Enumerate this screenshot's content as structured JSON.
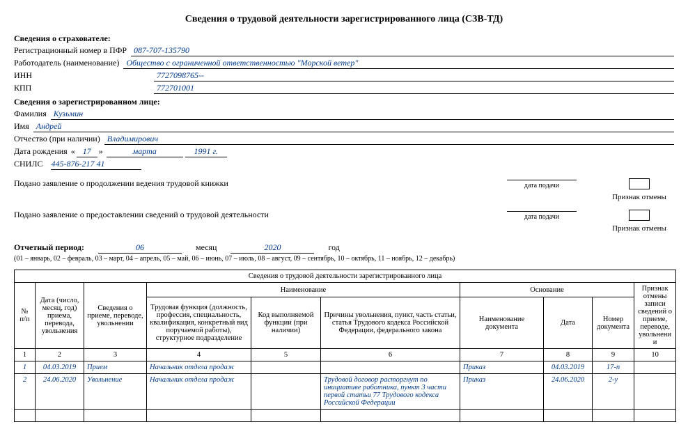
{
  "title": "Сведения о трудовой деятельности зарегистрированного лица (СЗВ-ТД)",
  "insurer": {
    "head": "Сведения о страхователе:",
    "reg_lbl": "Регистрационный номер в ПФР",
    "reg_val": "087-707-135790",
    "emp_lbl": "Работодатель (наименование)",
    "emp_val": "Общество с ограниченной ответственностью \"Морской ветер\"",
    "inn_lbl": "ИНН",
    "inn_val": "7727098765--",
    "kpp_lbl": "КПП",
    "kpp_val": "772701001"
  },
  "person": {
    "head": "Сведения о зарегистрированном лице:",
    "fam_lbl": "Фамилия",
    "fam_val": "Кузьмин",
    "name_lbl": "Имя",
    "name_val": "Андрей",
    "patr_lbl": "Отчество (при наличии)",
    "patr_val": "Владимирович",
    "dob_lbl": "Дата рождения",
    "dob_day": "17",
    "dob_month": "марта",
    "dob_year": "1991 г.",
    "snils_lbl": "СНИЛС",
    "snils_val": "445-876-217 41"
  },
  "appl": {
    "line1": "Подано заявление о продолжении ведения трудовой книжки",
    "line2": "Подано заявление о предоставлении сведений о трудовой деятельности",
    "date_lbl": "дата подачи",
    "cancel_lbl": "Признак отмены"
  },
  "period": {
    "lbl": "Отчетный период:",
    "month_val": "06",
    "month_lbl": "месяц",
    "year_val": "2020",
    "year_lbl": "год",
    "hint": "(01 – январь, 02 – февраль, 03 – март, 04 – апрель, 05 – май, 06 – июнь, 07 – июль, 08 – август, 09 – сентябрь, 10 – октябрь, 11 – ноябрь, 12 – декабрь)"
  },
  "table": {
    "caption": "Сведения о трудовой деятельности зарегистрированного лица",
    "hdr": {
      "npp": "№ п/п",
      "date": "Дата (число, месяц, год) приема, перевода, увольнения",
      "event": "Сведения о приеме, переводе, увольнении",
      "naim": "Наименование",
      "func": "Трудовая функция (должность, профессия, специальность, квалификация, конкретный вид поручаемой работы), структурное подразделение",
      "code": "Код выполняемой функции (при наличии)",
      "reason": "Причины увольнения, пункт, часть статьи, статья Трудового кодекса Российской Федерации, федерального закона",
      "osn": "Основание",
      "doc": "Наименование документа",
      "ddate": "Дата",
      "dnum": "Номер документа",
      "cancel": "Признак отмены записи сведений о приеме, переводе, увольнении"
    },
    "nums": [
      "1",
      "2",
      "3",
      "4",
      "5",
      "6",
      "7",
      "8",
      "9",
      "10"
    ],
    "rows": [
      {
        "n": "1",
        "date": "04.03.2019",
        "event": "Прием",
        "func": "Начальник отдела продаж",
        "code": "",
        "reason": "",
        "doc": "Приказ",
        "ddate": "04.03.2019",
        "dnum": "17-п",
        "cancel": ""
      },
      {
        "n": "2",
        "date": "24.06.2020",
        "event": "Увольнение",
        "func": "Начальник отдела продаж",
        "code": "",
        "reason": "Трудовой договор расторгнут по инициативе работника, пункт 3 части первой статьи 77 Трудового кодекса Российской Федерации",
        "doc": "Приказ",
        "ddate": "24.06.2020",
        "dnum": "2-у",
        "cancel": ""
      }
    ]
  }
}
